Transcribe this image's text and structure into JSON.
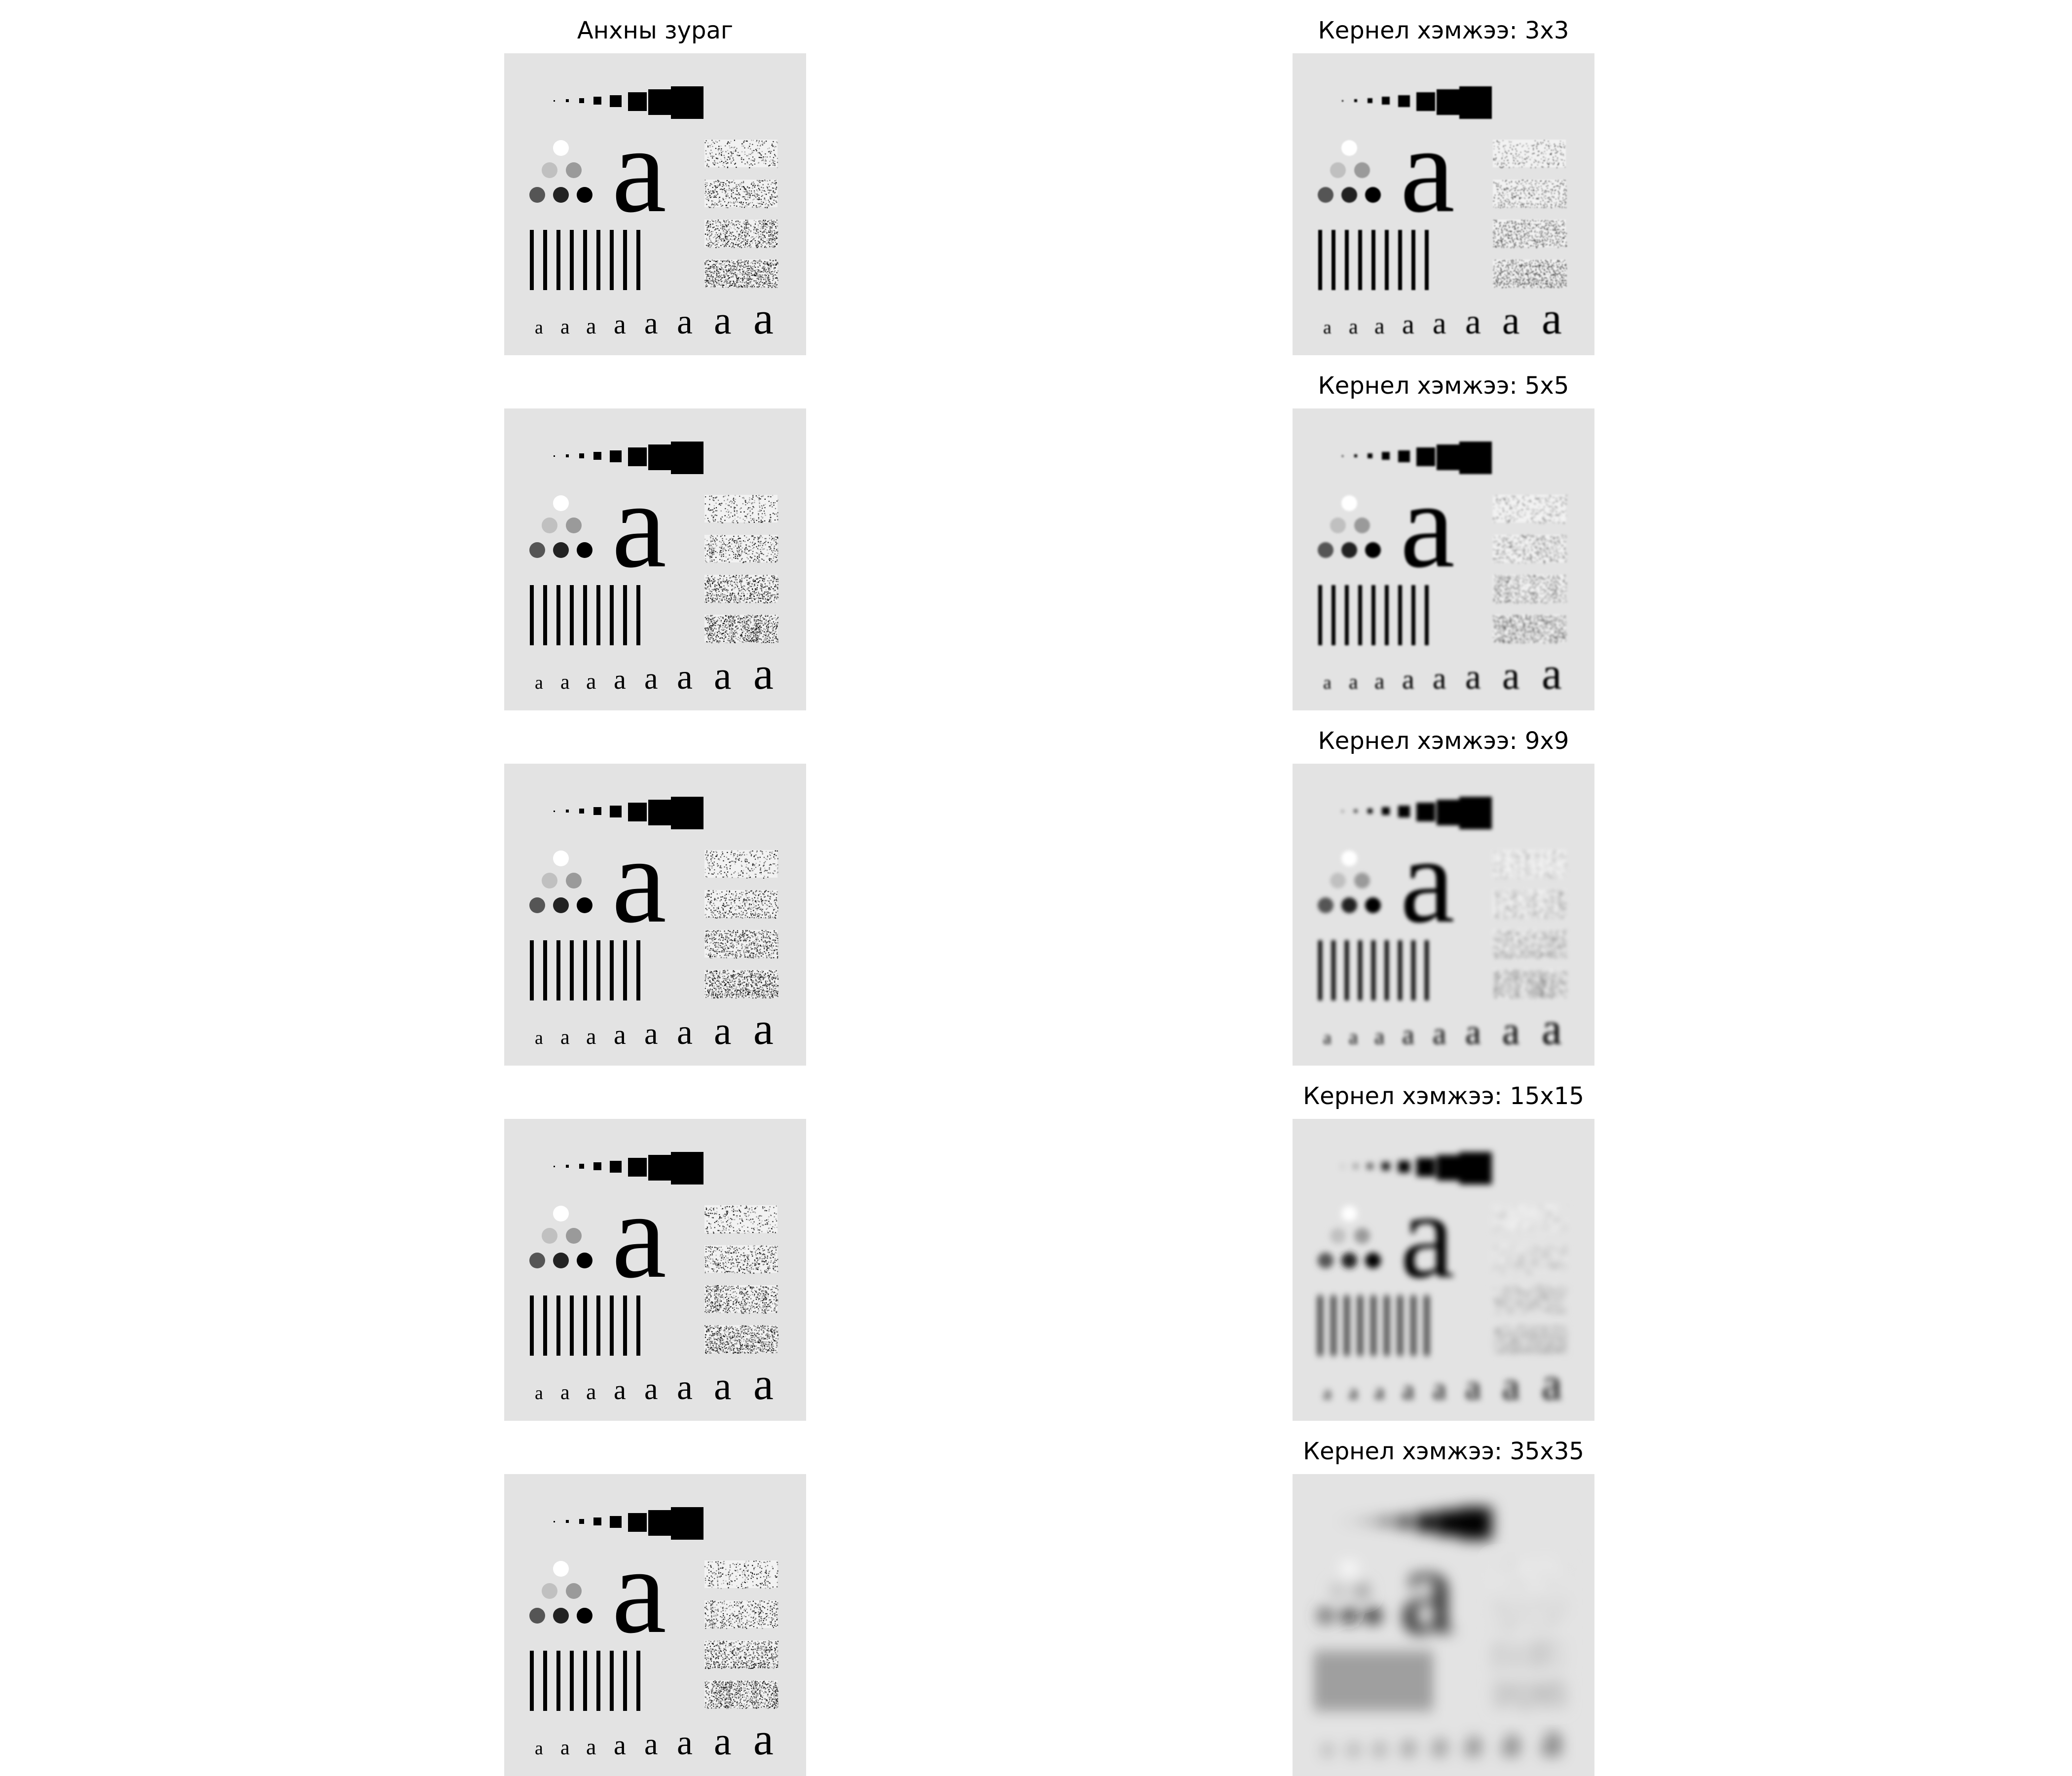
{
  "figure": {
    "original_title": "Анхны зураг",
    "kernel_titles": [
      "Кернел хэмжээ: 3x3",
      "Кернел хэмжээ: 5x5",
      "Кернел хэмжээ: 9x9",
      "Кернел хэмжээ: 15x15",
      "Кернел хэмжээ: 35x35"
    ],
    "kernel_sizes": [
      3,
      5,
      9,
      15,
      35
    ],
    "test_pattern_letter": "a",
    "colors": {
      "background": "#e3e3e3",
      "ink": "#000000",
      "gray_dark": "#555555",
      "gray_light": "#c0c0c0"
    }
  }
}
